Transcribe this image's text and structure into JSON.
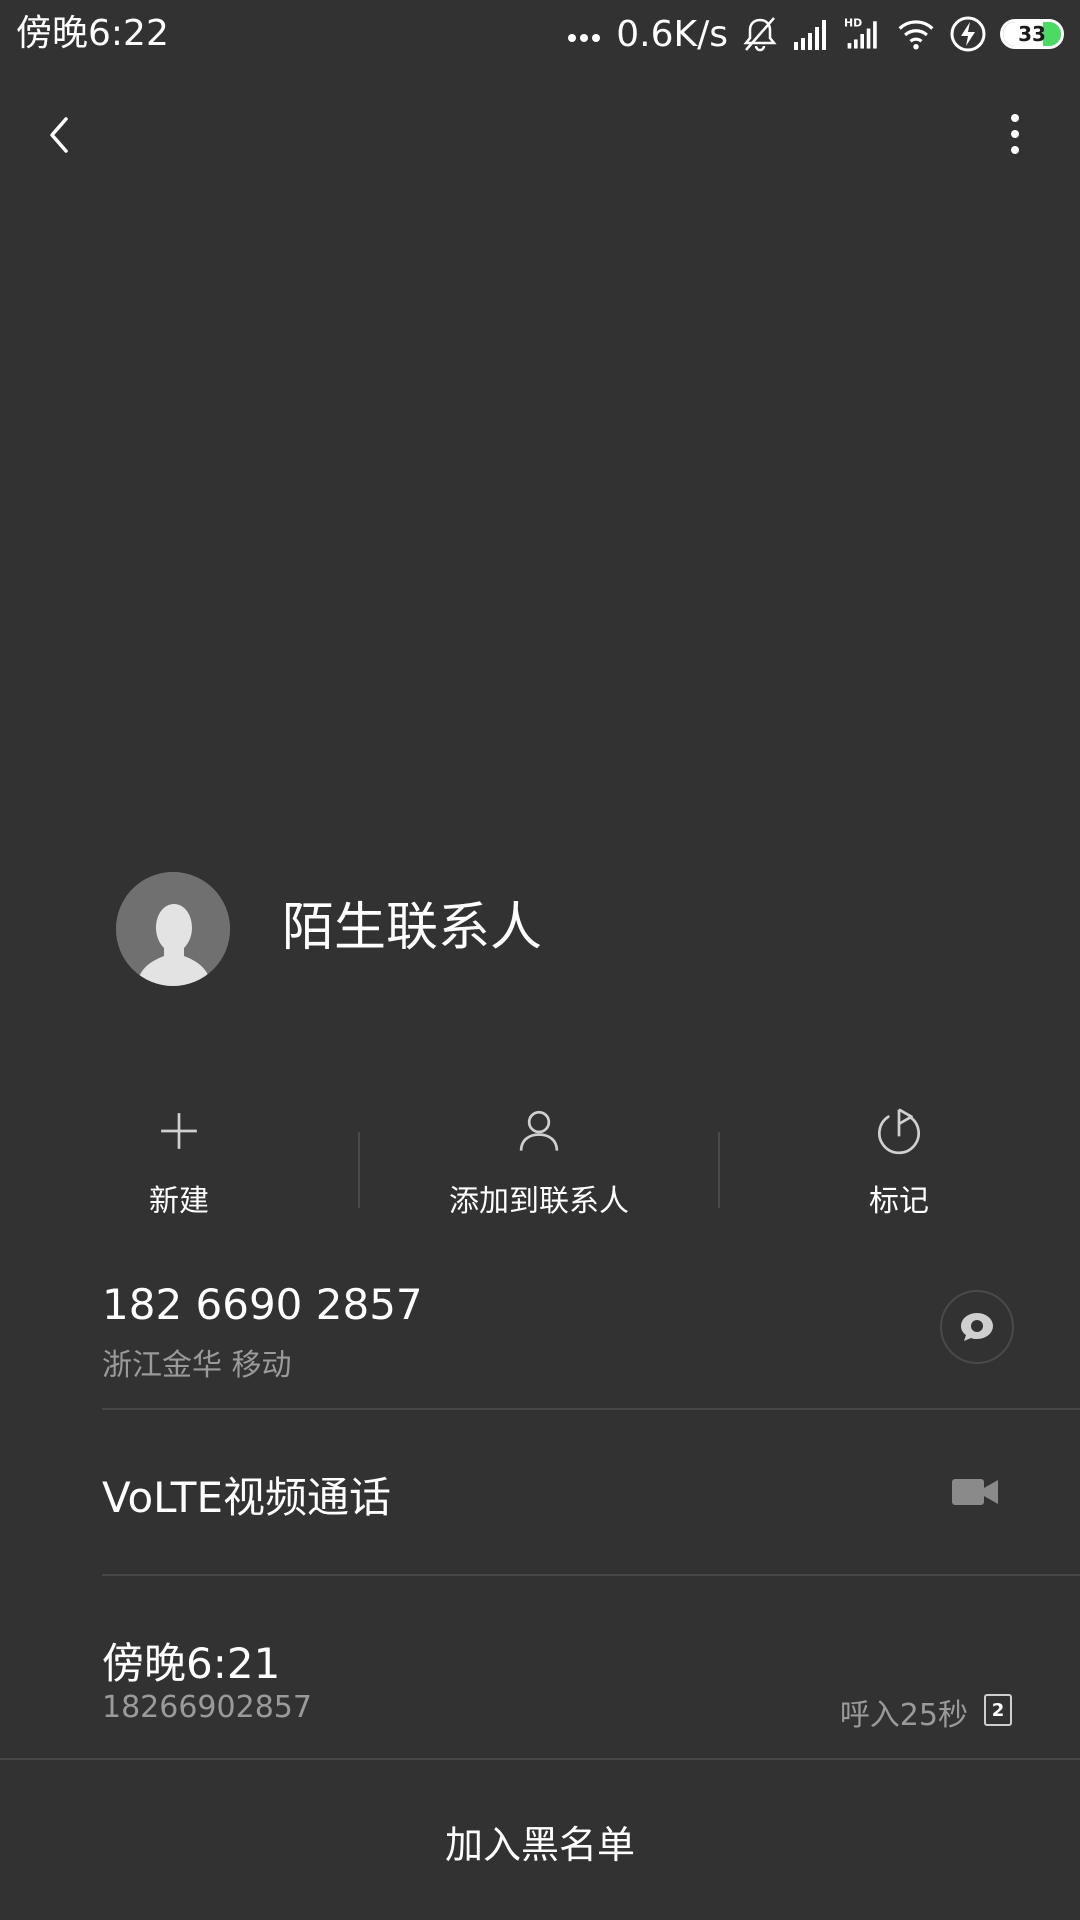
{
  "status_bar": {
    "time": "傍晚6:22",
    "net_speed": "0.6K/s",
    "battery": "33",
    "icons": [
      "more-dots-icon",
      "mute-bell-icon",
      "signal-icon",
      "hd-signal-icon",
      "wifi-icon",
      "charging-icon",
      "battery-icon"
    ]
  },
  "top_bar": {
    "back_icon": "back-chevron-icon",
    "more_icon": "overflow-menu-icon"
  },
  "contact": {
    "name": "陌生联系人",
    "avatar_icon": "default-avatar-icon"
  },
  "actions": [
    {
      "label": "新建",
      "icon": "plus-icon"
    },
    {
      "label": "添加到联系人",
      "icon": "person-icon"
    },
    {
      "label": "标记",
      "icon": "flag-icon"
    }
  ],
  "number_row": {
    "number": "182 6690 2857",
    "location": "浙江金华 移动",
    "action_icon": "message-icon"
  },
  "video_row": {
    "label": "VoLTE视频通话",
    "action_icon": "video-camera-icon"
  },
  "call_log": {
    "time": "傍晚6:21",
    "number": "18266902857",
    "duration": "呼入25秒",
    "sim": "2"
  },
  "bottom": {
    "block_label": "加入黑名单"
  },
  "colors": {
    "background": "#323232",
    "divider": "#474747",
    "secondary_text": "#9a9a9a",
    "battery_accent": "#4cd964"
  }
}
